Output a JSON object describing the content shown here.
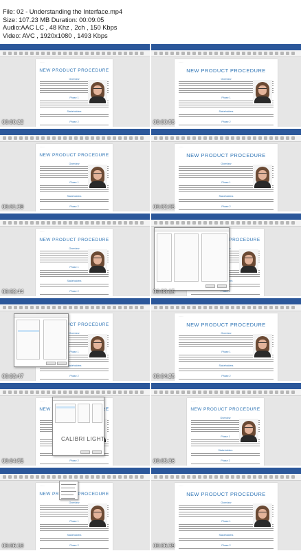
{
  "info": {
    "file": "File: 02 - Understanding the Interface.mp4",
    "size": "Size: 107.23 MB Duration: 00:09:05",
    "audio": "Audio:AAC LC , 48 Khz , 2ch , 150 Kbps",
    "video": "Video: AVC , 1920x1080 , 1493 Kbps"
  },
  "document": {
    "title": "NEW PRODUCT PROCEDURE",
    "overview": "Overview",
    "phase1": "Phase 1",
    "phase2": "Phase 2",
    "stakeholders": "Stakeholders"
  },
  "font_preview": "CALIBRI LIGHT",
  "thumbnails": [
    {
      "time": "00:00:22",
      "variant": "doc"
    },
    {
      "time": "00:00:55",
      "variant": "doc-zoom"
    },
    {
      "time": "00:01:39",
      "variant": "doc"
    },
    {
      "time": "00:02:05",
      "variant": "doc-zoom"
    },
    {
      "time": "00:02:44",
      "variant": "doc"
    },
    {
      "time": "00:03:15",
      "variant": "dialog-wide"
    },
    {
      "time": "00:03:47",
      "variant": "dialog-left"
    },
    {
      "time": "00:04:25",
      "variant": "doc-zoom"
    },
    {
      "time": "00:04:55",
      "variant": "dialog-font"
    },
    {
      "time": "00:05:36",
      "variant": "doc-menu"
    },
    {
      "time": "00:06:10",
      "variant": "doc-dropdown"
    },
    {
      "time": "00:06:39",
      "variant": "doc-zoom"
    }
  ]
}
